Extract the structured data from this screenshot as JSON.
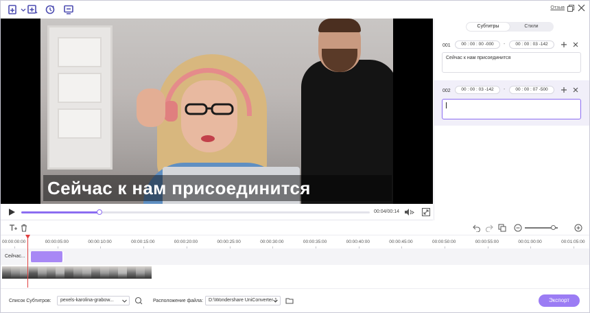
{
  "topbar": {
    "feedback_label": "Отзыв"
  },
  "player": {
    "subtitle_overlay": "Сейчас к нам присоединится",
    "time_readout": "00:04/00:14",
    "progress": 0.225
  },
  "panel": {
    "tabs": [
      {
        "label": "Субтитры",
        "active": true
      },
      {
        "label": "Стили",
        "active": false
      }
    ],
    "entries": [
      {
        "num": "001",
        "start": "00 : 00 : 00 -000",
        "end": "00 : 00 : 03 -142",
        "text": "Сейчас к нам присоединится",
        "selected": false
      },
      {
        "num": "002",
        "start": "00 : 00 : 03 -142",
        "end": "00 : 00 : 07 -500",
        "text": "",
        "selected": true
      }
    ],
    "separator": "-"
  },
  "timeline": {
    "ticks": [
      "00:00:00:00",
      "00:00:05:00",
      "00:00:10:00",
      "00:00:15:00",
      "00:00:20:00",
      "00:00:25:00",
      "00:00:30:00",
      "00:00:35:00",
      "00:00:40:00",
      "00:00:45:00",
      "00:00:50:00",
      "00:00:55:00",
      "00:01:00:00",
      "00:01:05:00"
    ],
    "subtitle_track_label": "Сейчас...",
    "zoom_level": 0.85
  },
  "bottom": {
    "subtitle_list_label": "Список Субтитров:",
    "subtitle_file": "pexels-karolina-grabow...",
    "file_location_label": "Расположение файла:",
    "file_location": "D:\\Wondershare UniConverter 1",
    "export_label": "Экспорт"
  },
  "colors": {
    "accent": "#9b7cf4",
    "playhead": "#e04040"
  }
}
